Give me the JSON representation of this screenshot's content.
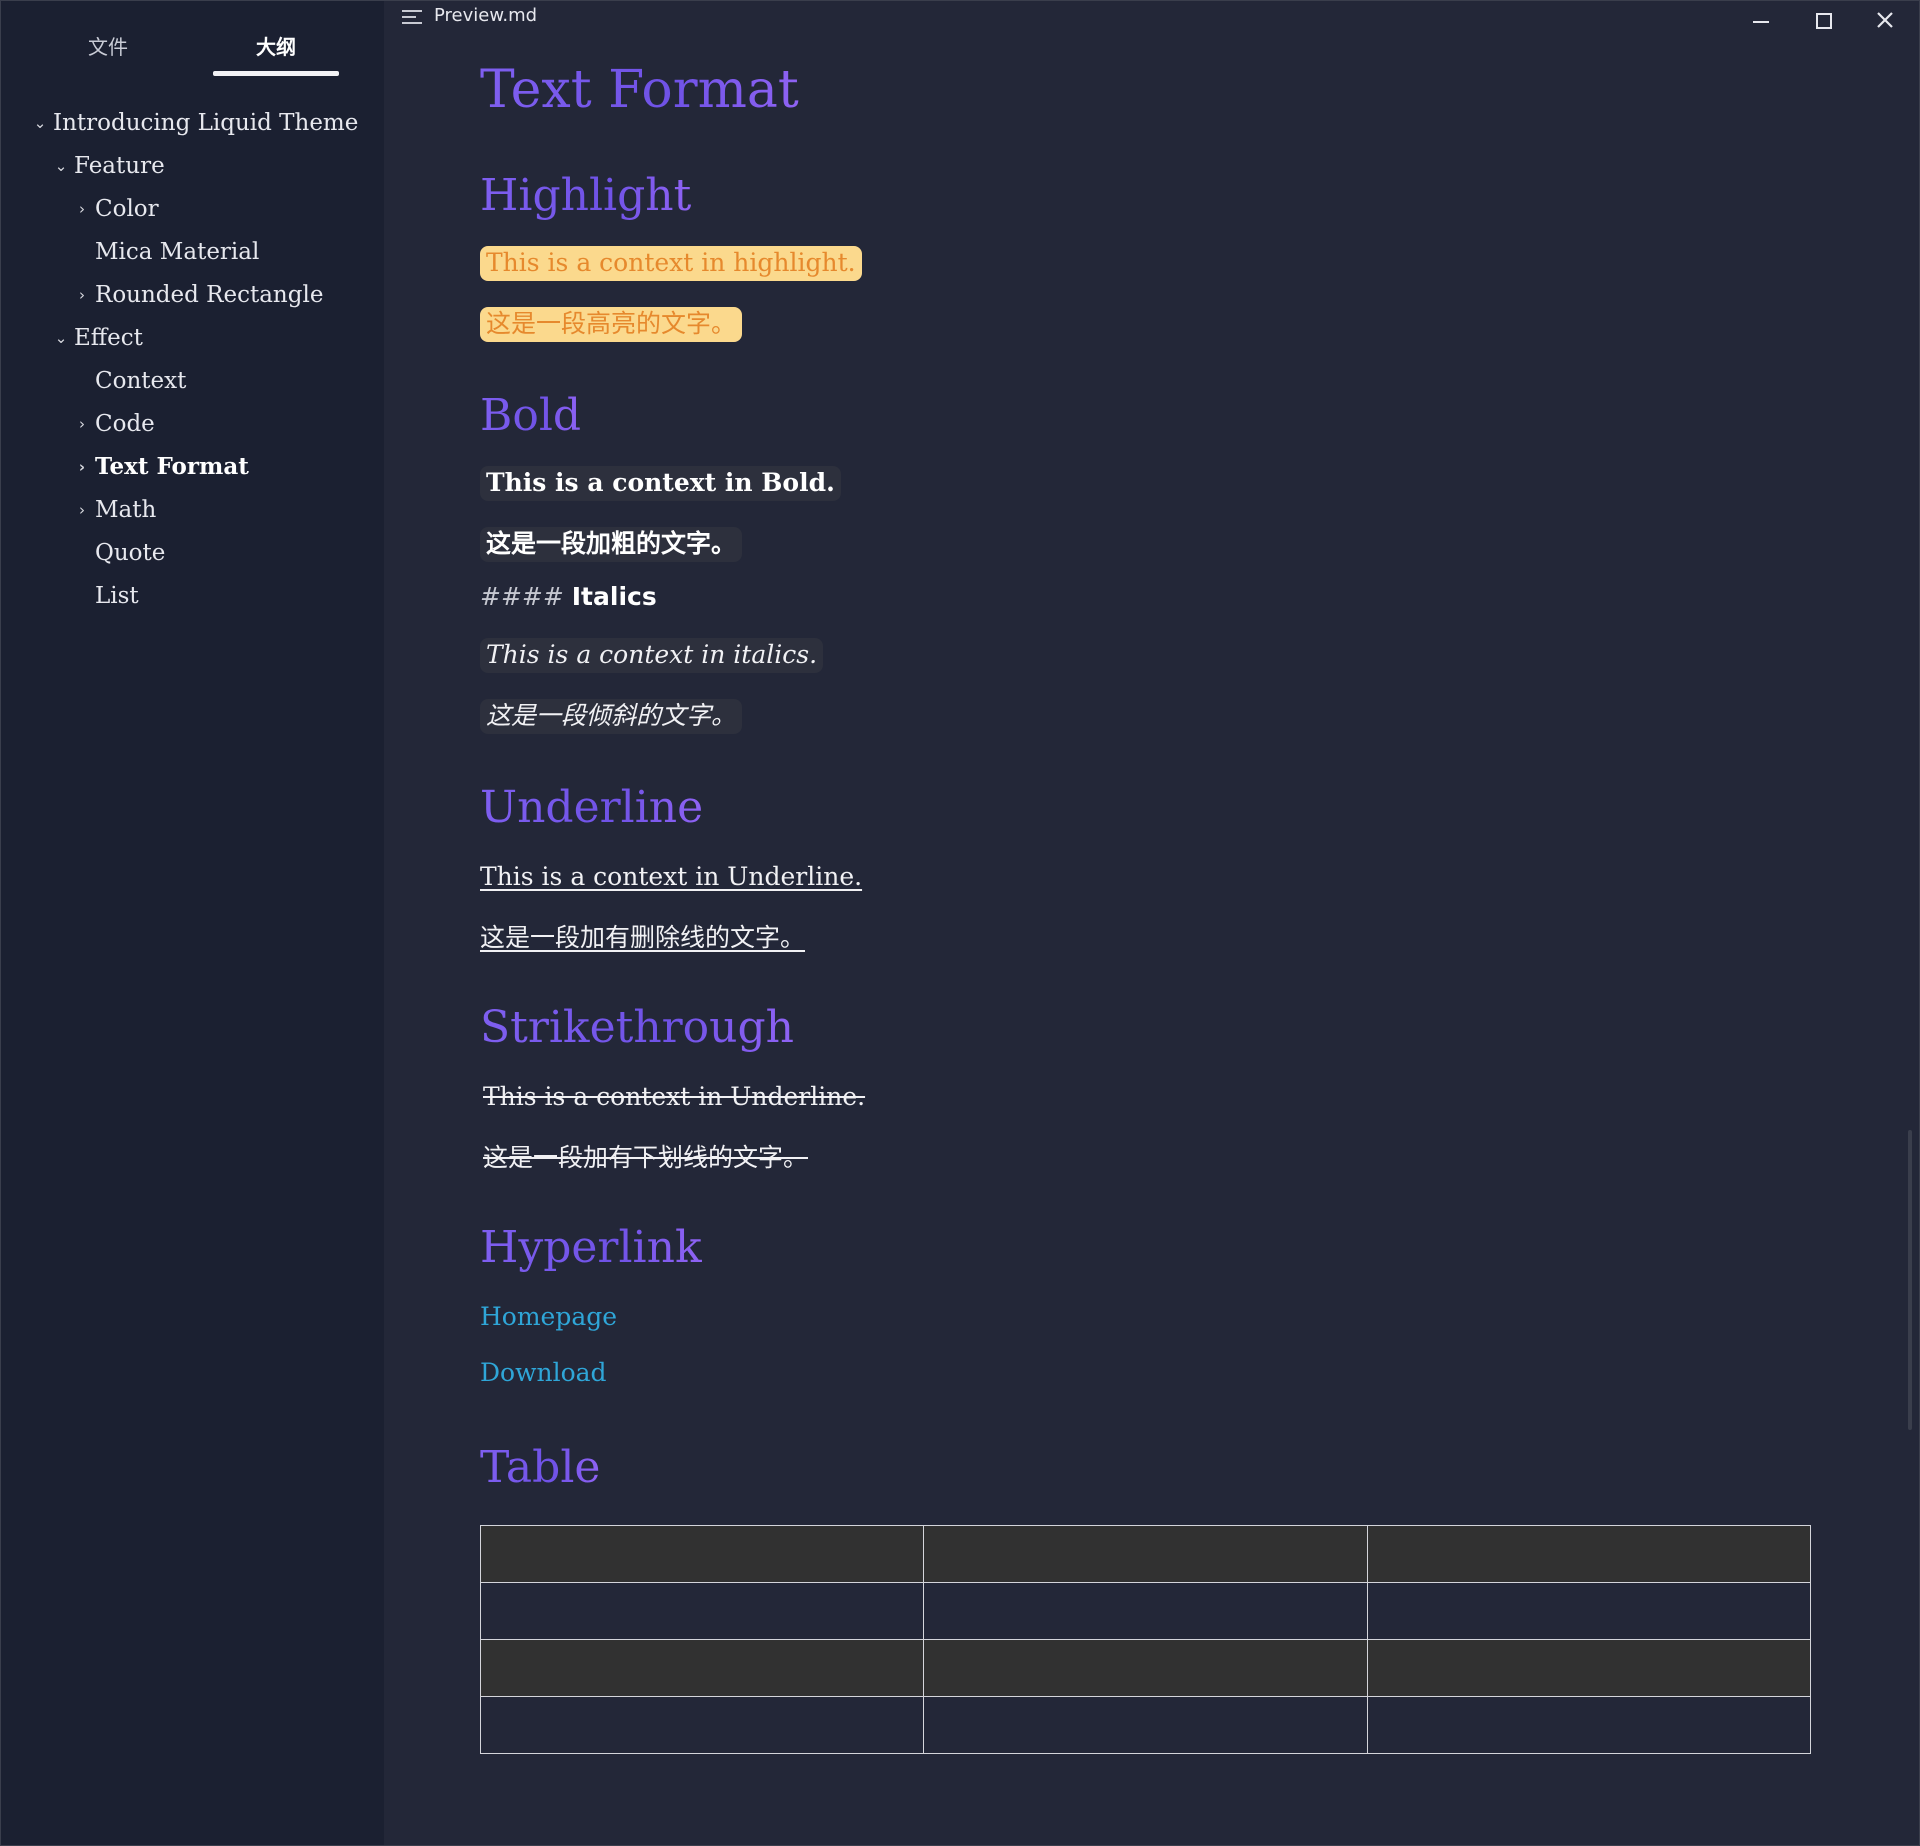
{
  "window": {
    "title": "Preview.md"
  },
  "sidebar": {
    "tabs": [
      {
        "label": "文件"
      },
      {
        "label": "大纲"
      }
    ],
    "outline": [
      {
        "label": "Introducing Liquid Theme",
        "chevron": "down"
      },
      {
        "label": "Feature",
        "chevron": "down"
      },
      {
        "label": "Color",
        "chevron": "right"
      },
      {
        "label": "Mica Material",
        "chevron": "none"
      },
      {
        "label": "Rounded Rectangle",
        "chevron": "right"
      },
      {
        "label": "Effect",
        "chevron": "down"
      },
      {
        "label": "Context",
        "chevron": "none"
      },
      {
        "label": "Code",
        "chevron": "right"
      },
      {
        "label": "Text Format",
        "chevron": "right"
      },
      {
        "label": "Math",
        "chevron": "right"
      },
      {
        "label": "Quote",
        "chevron": "none"
      },
      {
        "label": "List",
        "chevron": "none"
      }
    ]
  },
  "doc": {
    "title": "Text Format",
    "highlight": {
      "heading": "Highlight",
      "en": "This is a context in highlight.",
      "zh": "这是一段高亮的文字。"
    },
    "bold": {
      "heading": "Bold",
      "en": "This is a context in Bold.",
      "zh": "这是一段加粗的文字。"
    },
    "italics": {
      "raw_marker": "####",
      "heading": "Italics",
      "en": "This is a context in italics.",
      "zh": "这是一段倾斜的文字。"
    },
    "underline": {
      "heading": "Underline",
      "en": "This is a context in Underline.",
      "zh": "这是一段加有删除线的文字。"
    },
    "strikethrough": {
      "heading": "Strikethrough",
      "en": "This is a context in Underline.",
      "zh": "这是一段加有下划线的文字。"
    },
    "hyperlink": {
      "heading": "Hyperlink",
      "links": [
        "Homepage",
        "Download"
      ]
    },
    "table": {
      "heading": "Table",
      "rows": [
        [
          "",
          "",
          ""
        ],
        [
          "",
          "",
          ""
        ],
        [
          "",
          "",
          ""
        ],
        [
          "",
          "",
          ""
        ]
      ]
    }
  },
  "colors": {
    "background": "#232738",
    "sidebar": "#1b2031",
    "heading_accent": "#7459ea",
    "highlight_bg": "#fbd98d",
    "highlight_text": "#e6892d",
    "link": "#2fa6d8"
  }
}
